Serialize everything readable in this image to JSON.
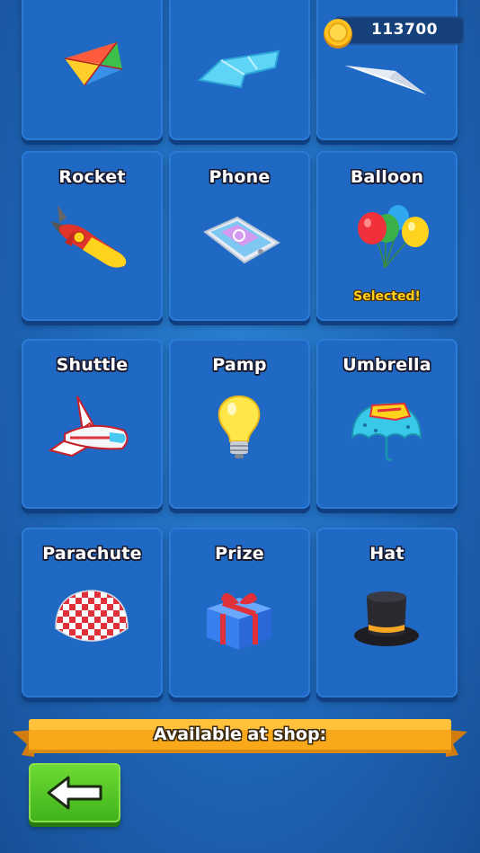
{
  "coins": {
    "value": "113700",
    "icon": "gold-coin-icon"
  },
  "settings": {
    "icon": "screw-settings-icon"
  },
  "cards": [
    {
      "name": "",
      "icon": "kite-icon",
      "status": ""
    },
    {
      "name": "",
      "icon": "glider-wing-icon",
      "status": ""
    },
    {
      "name": "",
      "icon": "paper-plane-icon",
      "status": ""
    },
    {
      "name": "Rocket",
      "icon": "rocket-icon",
      "status": ""
    },
    {
      "name": "Phone",
      "icon": "phone-icon",
      "status": ""
    },
    {
      "name": "Balloon",
      "icon": "balloons-icon",
      "status": "Selected!"
    },
    {
      "name": "Shuttle",
      "icon": "space-shuttle-icon",
      "status": ""
    },
    {
      "name": "Pamp",
      "icon": "light-bulb-icon",
      "status": ""
    },
    {
      "name": "Umbrella",
      "icon": "umbrella-icon",
      "status": ""
    },
    {
      "name": "Parachute",
      "icon": "parachute-icon",
      "status": ""
    },
    {
      "name": "Prize",
      "icon": "gift-box-icon",
      "status": ""
    },
    {
      "name": "Hat",
      "icon": "top-hat-icon",
      "status": ""
    }
  ],
  "banner": {
    "text": "Available at shop:"
  },
  "back_button": {
    "icon": "back-arrow-icon"
  },
  "colors": {
    "background": "#1e66b8",
    "card": "#1f68c4",
    "selected": "#ffd21e",
    "banner": "#f7a619",
    "back_button": "#4cc424"
  }
}
